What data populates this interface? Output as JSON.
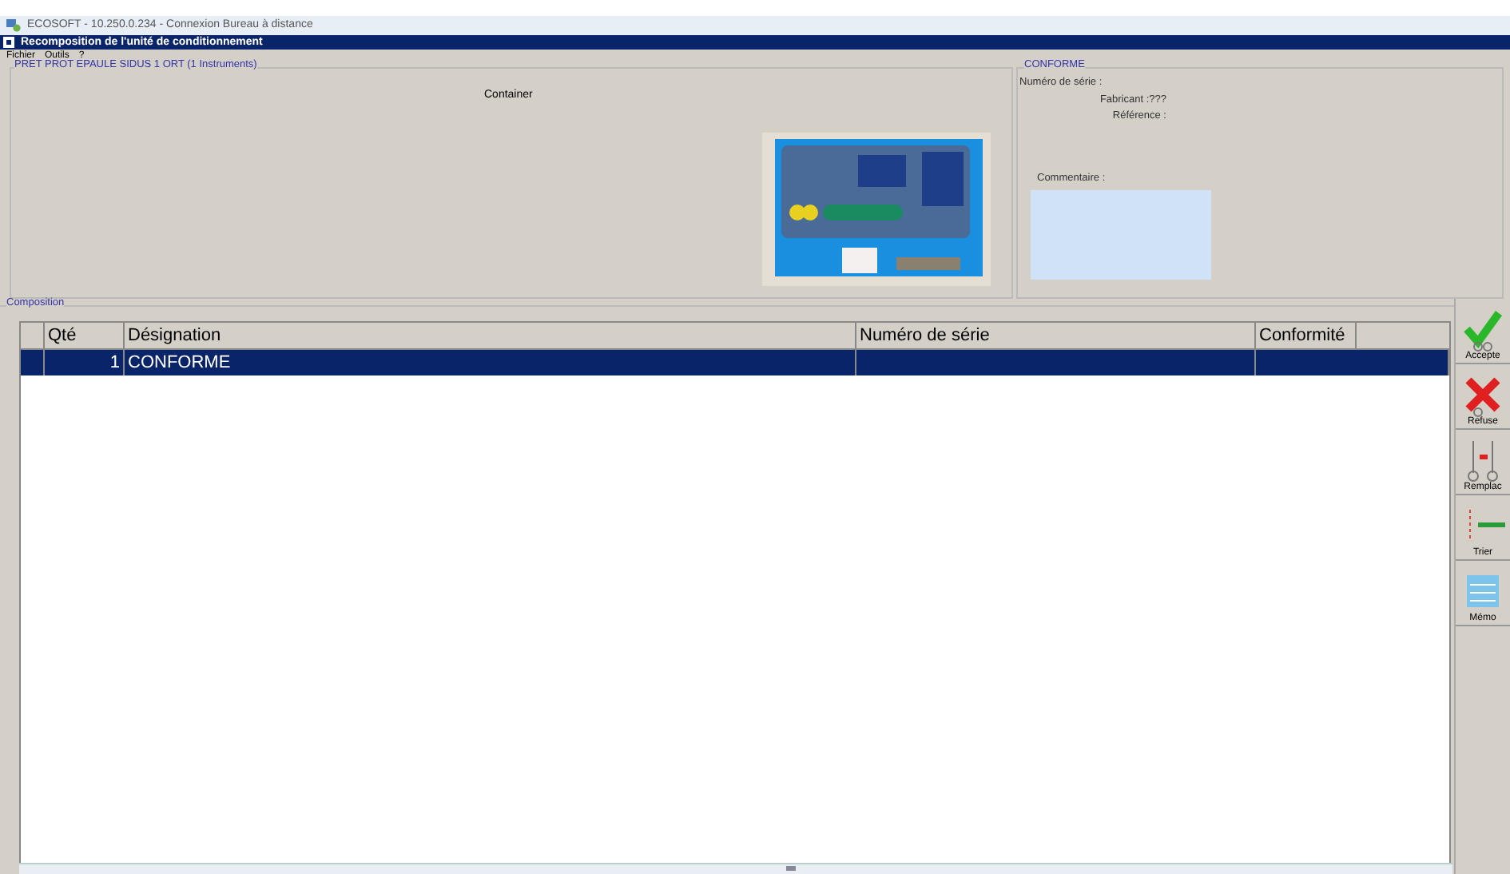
{
  "app_title": "ECOSOFT - 10.250.0.234 - Connexion Bureau à distance",
  "window": {
    "title": "Recomposition de l'unité de conditionnement"
  },
  "menu": [
    "Fichier",
    "Outils",
    "?"
  ],
  "set_panel": {
    "title": "PRET PROT EPAULE SIDUS 1 ORT (1 Instruments)",
    "label": "Container"
  },
  "status_panel": {
    "title": "CONFORME",
    "fields": [
      {
        "label": "Numéro de série :"
      },
      {
        "label": "Fabricant :",
        "value": "???"
      },
      {
        "label": "Référence :"
      }
    ],
    "comment_label": "Commentaire :"
  },
  "composition": {
    "title": "Composition",
    "columns": [
      "Qté",
      "Désignation",
      "Numéro de série",
      "Conformité"
    ],
    "rows": [
      {
        "cells": [
          "1",
          "CONFORME",
          null,
          null
        ],
        "selected": true
      }
    ]
  },
  "toolbar": [
    {
      "kind": "accept",
      "label": "Accepte"
    },
    {
      "kind": "refuse",
      "label": "Refuse"
    },
    {
      "kind": "replace",
      "label": "Remplac"
    },
    {
      "kind": "sort",
      "label": "Trier"
    },
    {
      "kind": "memo",
      "label": "Mémo"
    }
  ]
}
